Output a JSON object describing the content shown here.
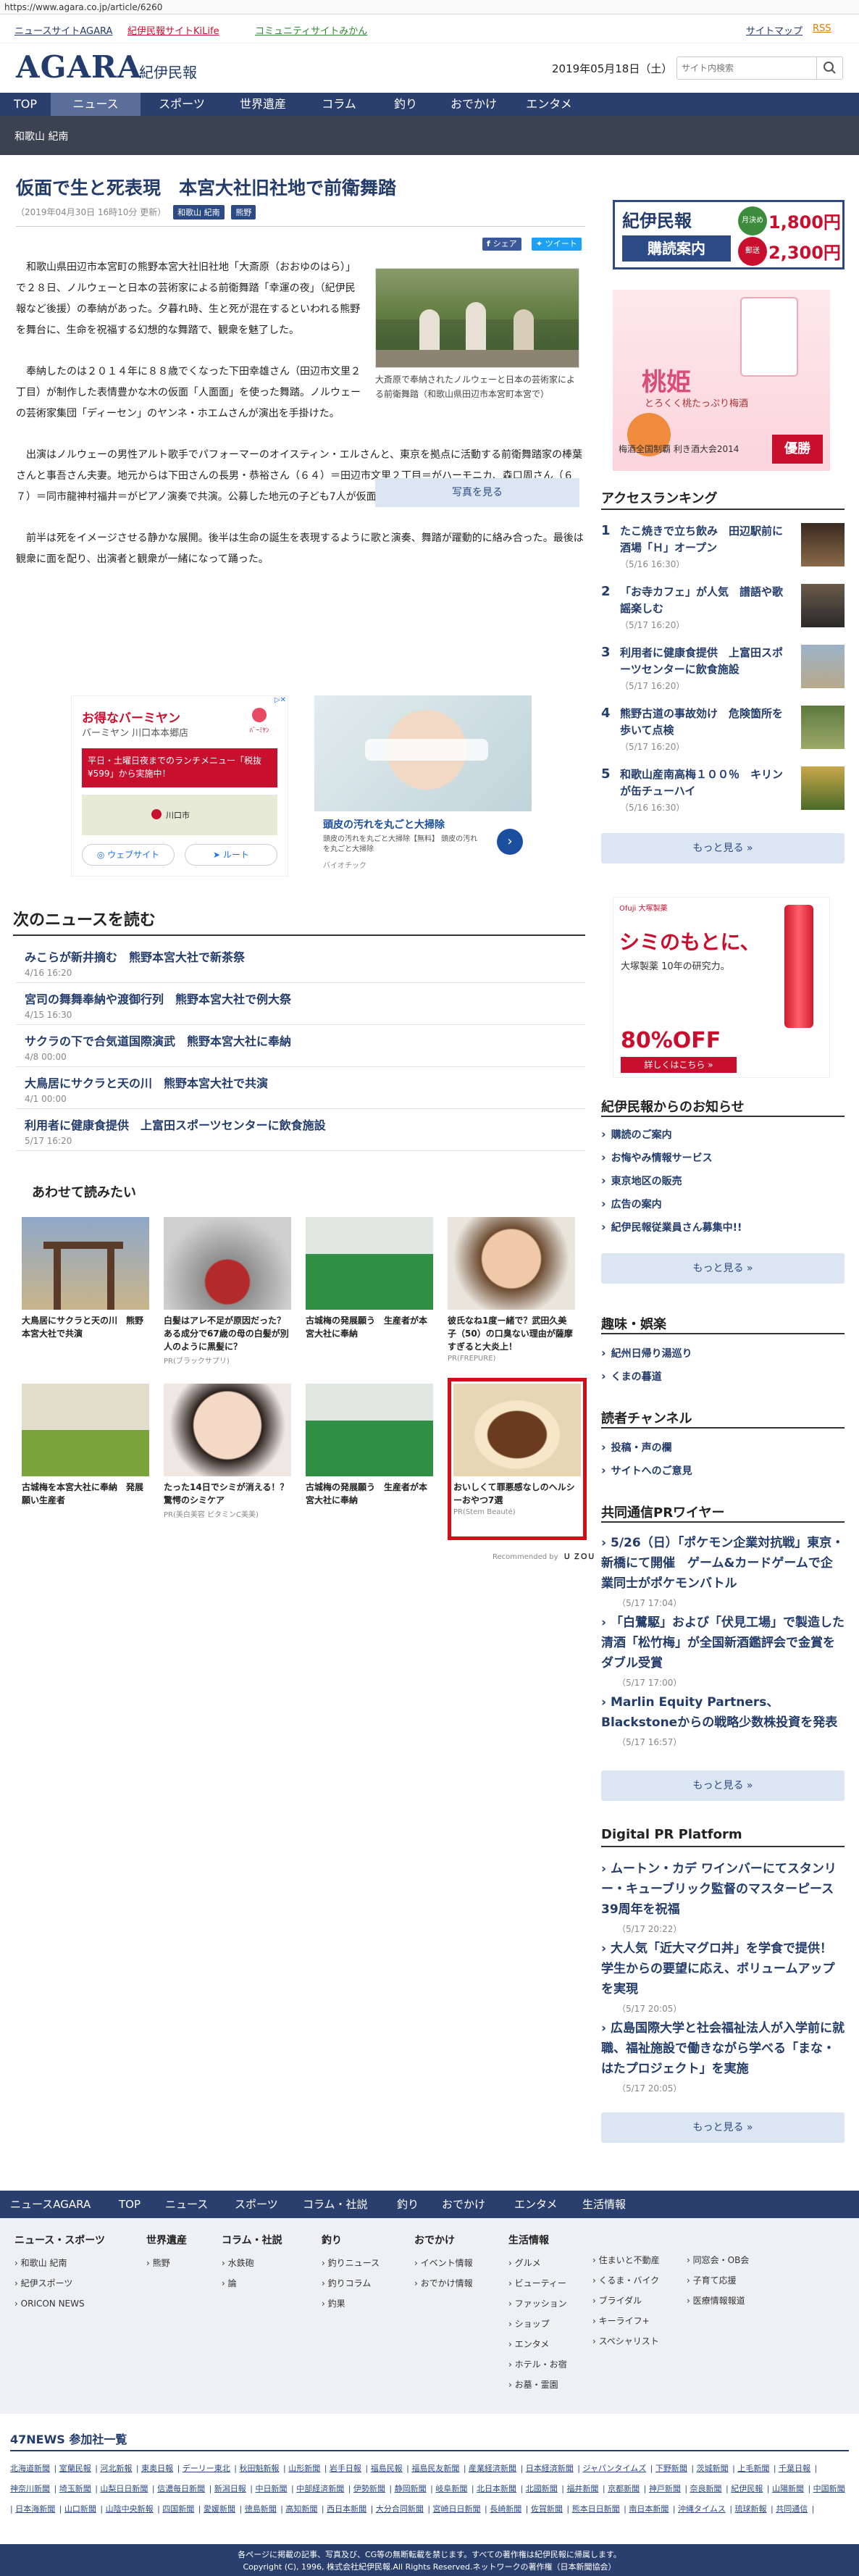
{
  "url": "https://www.agara.co.jp/article/6260",
  "topbar": {
    "left_links": [
      "ニュースサイトAGARA",
      "紀伊民報サイトKiLife",
      "コミュニティサイトみかん"
    ],
    "right_links": [
      "サイトマップ",
      "RSS"
    ]
  },
  "header": {
    "logo": "AGARA",
    "logo_sub": "紀伊民報",
    "date": "2019年05月18日（土）",
    "search_placeholder": "サイト内検索"
  },
  "nav": {
    "items": [
      "TOP",
      "ニュース",
      "スポーツ",
      "世界遺産",
      "コラム",
      "釣り",
      "おでかけ",
      "エンタメ"
    ],
    "active": "ニュース"
  },
  "subnav": {
    "label": "和歌山 紀南"
  },
  "article": {
    "title": "仮面で生と死表現　本宮大社旧社地で前衛舞踏",
    "meta": "（2019年04月30日 16時10分 更新）",
    "tags": [
      "和歌山 紀南",
      "熊野"
    ],
    "share": "シェア",
    "tweet": "ツイート",
    "paragraphs": [
      "和歌山県田辺市本宮町の熊野本宮大社旧社地「大斎原（おおゆのはら）」で２８日、ノルウェーと日本の芸術家による前衛舞踏「幸運の夜」（紀伊民報など後援）の奉納があった。夕暮れ時、生と死が混在するといわれる熊野を舞台に、生命を祝福する幻想的な舞踏で、観衆を魅了した。",
      "奉納したのは２０１４年に８８歳でくなった下田幸雄さん（田辺市文里２丁目）が制作した表情豊かな木の仮面「人面面」を使った舞踏。ノルウェーの芸術家集団「ディーセン」のヤンネ・ホエムさんが演出を手掛けた。",
      "出演はノルウェーの男性アルト歌手でパフォーマーのオイスティン・エルさんと、東京を拠点に活動する前衛舞踏家の棒葉さんと事吾さん夫妻。地元からは下田さんの長男・恭裕さん（６４）＝田辺市文里２丁目＝がハーモニカ、森口周さん（６７）＝同市龍神村福井＝がピアノ演奏で共演。公募した地元の子ども7人が仮面を着けて参加した。",
      "前半は死をイメージさせる静かな展開。後半は生命の誕生を表現するように歌と演奏、舞踏が躍動的に絡み合った。最後は観衆に面を配り、出演者と観衆が一緒になって踊った。"
    ],
    "photo_caption": "大斎原で奉納されたノルウェーと日本の芸術家による前衛舞踏（和歌山県田辺市本宮町本宮で）",
    "photo_button": "写真を見る"
  },
  "ads": {
    "ad1_title": "お得なバーミヤン",
    "ad1_sub": "バーミヤン 川口本本郷店",
    "ad1_msg": "平日・土曜日夜までのランチメニュー「税抜¥599」から実施中！",
    "ad1_map": "川口市",
    "ad1_web": "ウェブサイト",
    "ad1_route": "ルート",
    "ad2_title": "頭皮の汚れを丸ごと大掃除",
    "ad2_text": "頭皮の汚れを丸ごと大掃除【無料】 頭皮の汚れを丸ごと大掃除",
    "ad2_sponsor": "バイオチック"
  },
  "next_news": {
    "heading": "次のニュースを読む",
    "items": [
      {
        "title": "みこらが新井摘む　熊野本宮大社で新茶祭",
        "date": "4/16 16:20"
      },
      {
        "title": "宮司の舞舞奉納や渡御行列　熊野本宮大社で例大祭",
        "date": "4/15 16:30"
      },
      {
        "title": "サクラの下で合気道国際演武　熊野本宮大社に奉納",
        "date": "4/8 00:00"
      },
      {
        "title": "大鳥居にサクラと天の川　熊野本宮大社で共演",
        "date": "4/1 00:00"
      },
      {
        "title": "利用者に健康食提供　上富田スポーツセンターに飲食施設",
        "date": "5/17 16:20"
      }
    ]
  },
  "related": {
    "heading": "あわせて読みたい",
    "cards": [
      {
        "title": "大鳥居にサクラと天の川　熊野本宮大社で共演",
        "pr": ""
      },
      {
        "title": "白髪はアレ不足が原因だった？ある成分で67歳の母の白髪が別人のように黒髪に？",
        "pr": "PR(ブラックサプリ)"
      },
      {
        "title": "古城梅の発展願う　生産者が本宮大社に奉納",
        "pr": ""
      },
      {
        "title": "彼氏なね1度ー緒で？武田久美子（50）の口臭ない理由が薩摩すぎると大炎上！",
        "pr": "PR(FREPURE)"
      },
      {
        "title": "古城梅を本宮大社に奉納　発展願い生産者",
        "pr": ""
      },
      {
        "title": "たった14日でシミが消える！？驚愕のシミケア",
        "pr": "PR(美白美容 ビタミンC美美)"
      },
      {
        "title": "古城梅の発展願う　生産者が本宮大社に奉納",
        "pr": ""
      },
      {
        "title": "おいしくて罪悪感なしのヘルシーおやつ7選",
        "pr": "PR(Stem Beauté)"
      }
    ],
    "recommended": "Recommended by",
    "recommended_brand": "Ｕ ＺＯＵ"
  },
  "sidebar": {
    "subscribe": {
      "brand": "紀伊民報",
      "label": "購読案内",
      "m1": "月決め",
      "p1": "1,800円",
      "m2": "郵送",
      "p2": "2,300円"
    },
    "ad_peach": {
      "title": "桃姫",
      "sub": "とろくく桃たっぷり梅酒",
      "award": "梅酒全国制覇 利き酒大会2014",
      "badge": "優勝"
    },
    "ranking": {
      "heading": "アクセスランキング",
      "items": [
        {
          "no": "1",
          "title": "たこ焼きで立ち飲み　田辺駅前に酒場「Ｈ」オープン",
          "date": "（5/16 16:30）"
        },
        {
          "no": "2",
          "title": "「お寺カフェ」が人気　譜語や歌謡楽しむ",
          "date": "（5/17 16:20）"
        },
        {
          "no": "3",
          "title": "利用者に健康食提供　上富田スポーツセンターに飲食施設",
          "date": "（5/17 16:20）"
        },
        {
          "no": "4",
          "title": "熊野古道の事故効け　危険箇所を歩いて点検",
          "date": "（5/17 16:20）"
        },
        {
          "no": "5",
          "title": "和歌山産南高梅１００％　キリンが缶チューハイ",
          "date": "（5/16 16:30）"
        }
      ],
      "more": "もっと見る »"
    },
    "ad_cosme": {
      "brand": "Ofuji 大塚製薬",
      "title": "シミのもとに、",
      "sub": "大塚製薬 10年の研究力。",
      "off": "80%OFF",
      "cta": "詳しくはこちら »"
    },
    "notice": {
      "heading": "紀伊民報からのお知らせ",
      "items": [
        "購読のご案内",
        "お悔やみ情報サービス",
        "東京地区の販売",
        "広告の案内",
        "紀伊民報従業員さん募集中!!"
      ],
      "more": "もっと見る »"
    },
    "hobby": {
      "heading": "趣味・娯楽",
      "items": [
        "紀州日帰り湯巡り",
        "くまの暮道"
      ]
    },
    "reader": {
      "heading": "読者チャンネル",
      "items": [
        "投稿・声の欄",
        "サイトへのご意見"
      ]
    },
    "wire": {
      "heading": "共同通信PRワイヤー",
      "items": [
        {
          "title": "5/26（日）「ポケモン企業対抗戦」東京・新橋にて開催　ゲーム&カードゲームで企業同士がポケモンバトル",
          "date": "（5/17 17:04）"
        },
        {
          "title": "「白鷺駆」および「伏見工場」で製造した清酒「松竹梅」が全国新酒鑑評会で金賞をダブル受賞",
          "date": "（5/17 17:00）"
        },
        {
          "title": "Marlin Equity Partners、Blackstoneからの戦略少数株投資を発表",
          "date": "（5/17 16:57）"
        }
      ],
      "more": "もっと見る »"
    },
    "digital": {
      "heading": "Digital PR Platform",
      "items": [
        {
          "title": "ムートン・カデ ワインバーにてスタンリー・キューブリック監督のマスターピース39周年を祝福",
          "date": "（5/17 20:22）"
        },
        {
          "title": "大人気「近大マグロ丼」を学食で提供！　学生からの要望に応え、ボリュームアップを実現",
          "date": "（5/17 20:05）"
        },
        {
          "title": "広島国際大学と社会福祉法人が入学前に就職、福祉施設で働きながら学べる「まな・はたプロジェクト」を実施",
          "date": "（5/17 20:05）"
        }
      ],
      "more": "もっと見る »"
    }
  },
  "footer": {
    "nav": [
      "ニュースAGARA",
      "TOP",
      "ニュース",
      "スポーツ",
      "コラム・社説",
      "釣り",
      "おでかけ",
      "エンタメ",
      "生活情報"
    ],
    "cols": [
      {
        "heading": "ニュース・スポーツ",
        "items": [
          "和歌山 紀南",
          "紀伊スポーツ",
          "ORICON NEWS"
        ]
      },
      {
        "heading": "世界遺産",
        "items": [
          "熊野"
        ]
      },
      {
        "heading": "コラム・社説",
        "items": [
          "水鉄砲",
          "論"
        ]
      },
      {
        "heading": "釣り",
        "items": [
          "釣りニュース",
          "釣りコラム",
          "釣果"
        ]
      },
      {
        "heading": "おでかけ",
        "items": [
          "イベント情報",
          "おでかけ情報"
        ]
      },
      {
        "heading": "生活情報",
        "items": [
          "グルメ",
          "ビューティー",
          "ファッション",
          "ショップ",
          "エンタメ",
          "ホテル・お宿",
          "お墓・霊園"
        ]
      },
      {
        "heading": "",
        "items": [
          "住まいと不動産",
          "くるま・バイク",
          "ブライダル",
          "キーライフ+",
          "スペシャリスト"
        ]
      },
      {
        "heading": "",
        "items": [
          "同窓会・OB会",
          "子育て応援",
          "医療情報報道"
        ]
      }
    ],
    "news47": "47NEWS 参加社一覧",
    "news47_links": [
      "北海道新聞",
      "室蘭民報",
      "河北新報",
      "東奥日報",
      "デーリー東北",
      "秋田魁新報",
      "山形新聞",
      "岩手日報",
      "福島民報",
      "福島民友新聞",
      "産業経済新聞",
      "日本経済新聞",
      "ジャパンタイムズ",
      "下野新聞",
      "茨城新聞",
      "上毛新聞",
      "千葉日報",
      "神奈川新聞",
      "埼玉新聞",
      "山梨日日新聞",
      "信濃毎日新聞",
      "新潟日報",
      "中日新聞",
      "中部経済新聞",
      "伊勢新聞",
      "静岡新聞",
      "岐阜新聞",
      "北日本新聞",
      "北國新聞",
      "福井新聞",
      "京都新聞",
      "神戸新聞",
      "奈良新聞",
      "紀伊民報",
      "山陽新聞",
      "中国新聞",
      "日本海新聞",
      "山口新聞",
      "山陰中央新報",
      "四国新聞",
      "愛媛新聞",
      "徳島新聞",
      "高知新聞",
      "西日本新聞",
      "大分合同新聞",
      "宮崎日日新聞",
      "長崎新聞",
      "佐賀新聞",
      "熊本日日新聞",
      "南日本新聞",
      "沖縄タイムス",
      "琉球新報",
      "共同通信"
    ],
    "copy1": "各ページに掲載の記事、写真及び、CG等の無断転載を禁じます。すべての著作権は紀伊民報に帰属します。",
    "copy2": "Copyright (C), 1996, 株式会社紀伊民報.All Rights Reserved.ネットワークの著作権（日本新聞協会）"
  },
  "colors": {
    "brand": "#243c6b",
    "nav": "#2b3f6e",
    "accent_red": "#c8102e"
  }
}
